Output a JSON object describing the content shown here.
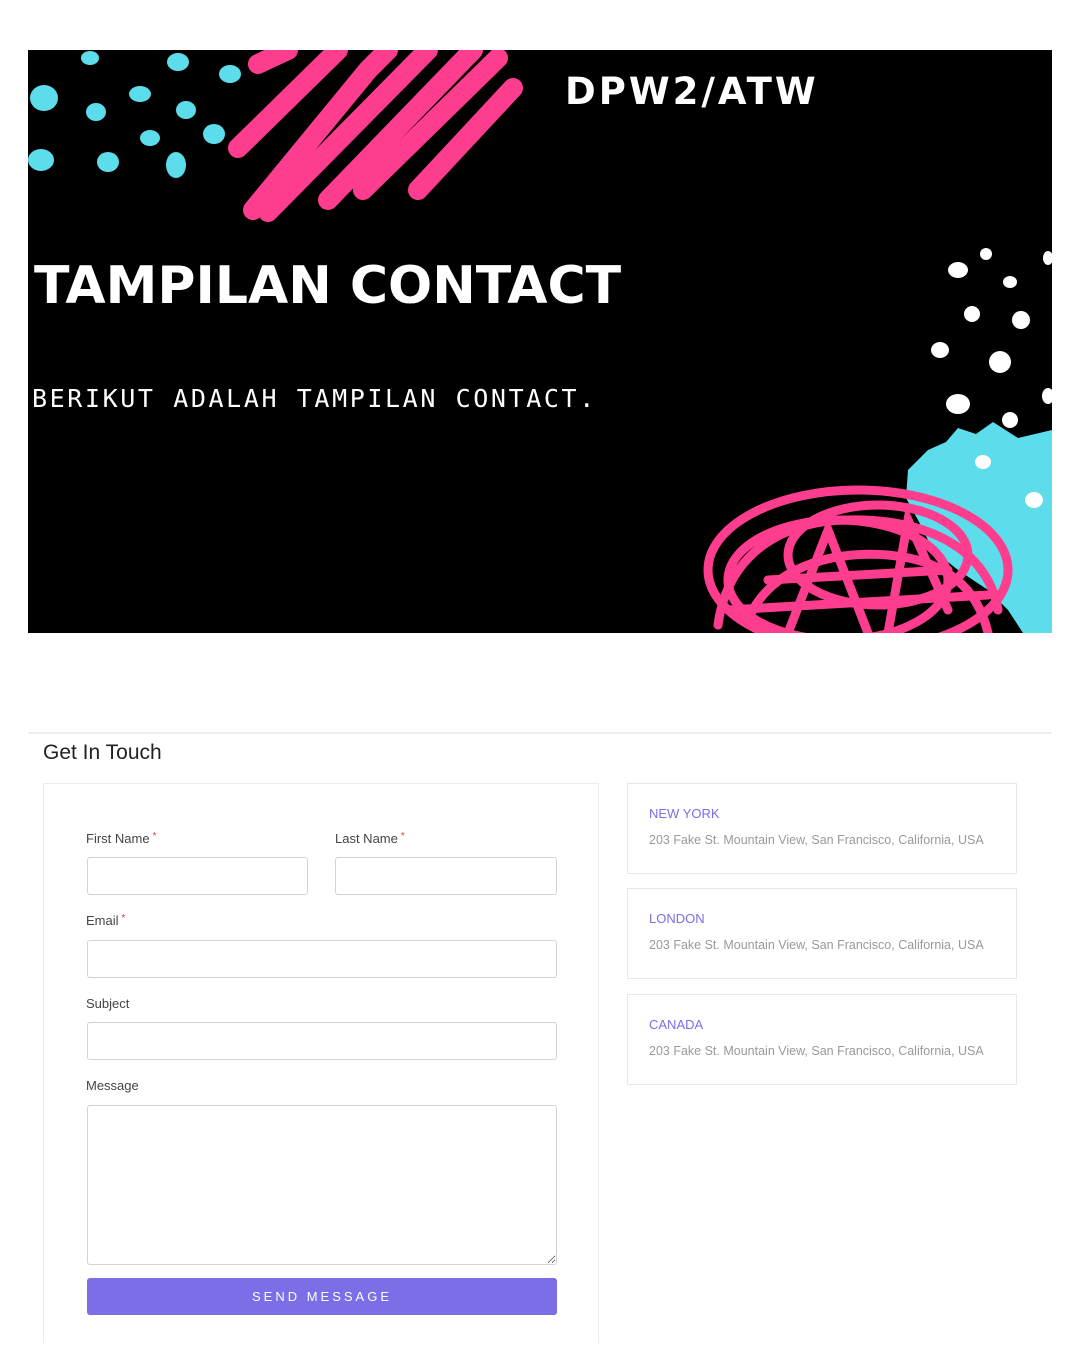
{
  "banner": {
    "tag": "DPW2/ATW",
    "headline": "TAMPILAN CONTACT",
    "subline": "BERIKUT ADALAH TAMPILAN CONTACT.",
    "colors": {
      "background": "#000000",
      "pink": "#ff3d8f",
      "cyan": "#5ddcec",
      "white": "#ffffff"
    }
  },
  "contact": {
    "title": "Get In Touch",
    "form": {
      "first_name_label": "First Name",
      "last_name_label": "Last Name",
      "email_label": "Email",
      "subject_label": "Subject",
      "message_label": "Message",
      "required_mark": "*",
      "first_name_value": "",
      "last_name_value": "",
      "email_value": "",
      "subject_value": "",
      "message_value": "",
      "send_label": "SEND MESSAGE"
    },
    "offices": [
      {
        "city": "NEW YORK",
        "address": "203 Fake St. Mountain View, San Francisco, California, USA"
      },
      {
        "city": "LONDON",
        "address": "203 Fake St. Mountain View, San Francisco, California, USA"
      },
      {
        "city": "CANADA",
        "address": "203 Fake St. Mountain View, San Francisco, California, USA"
      }
    ],
    "colors": {
      "accent": "#7b6ee6",
      "required": "#e53935"
    }
  }
}
